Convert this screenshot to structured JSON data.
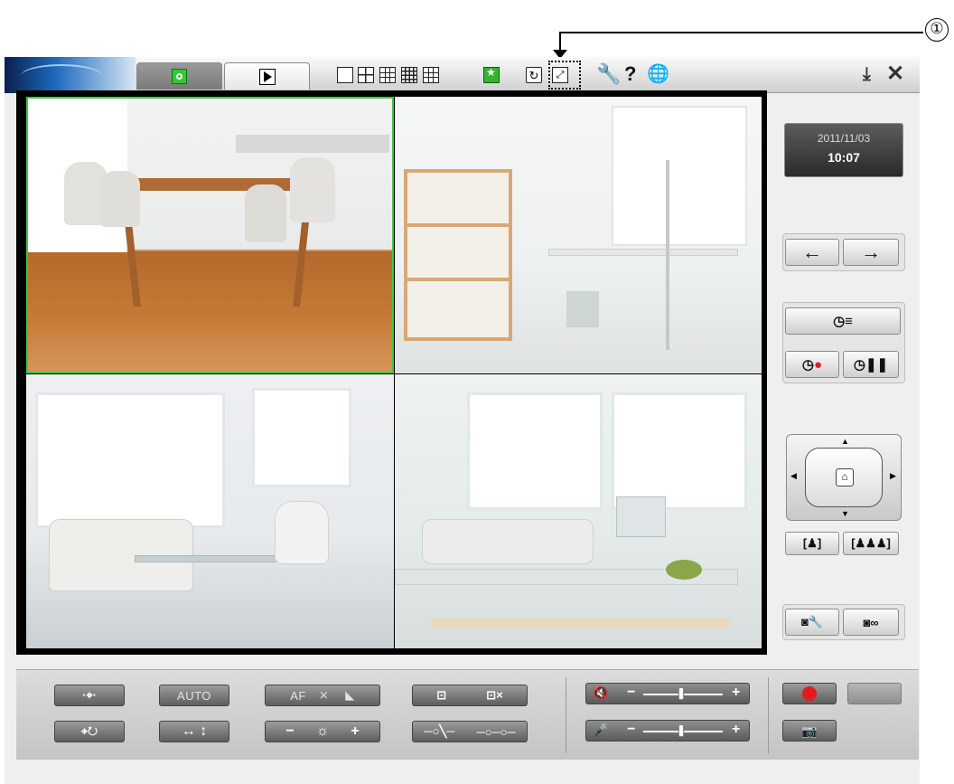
{
  "callout": {
    "number": "①"
  },
  "topbar": {
    "tabs": [
      {
        "name": "live"
      },
      {
        "name": "playback"
      }
    ],
    "tools": [
      "single-view",
      "quad-view",
      "nine-view",
      "sixteen-view",
      "twelve-view",
      "sequence-view",
      "refresh",
      "fullscreen",
      "settings",
      "help",
      "language"
    ]
  },
  "datetime": {
    "date": "2011/11/03",
    "time": "10:07"
  },
  "bottom": {
    "auto_label": "AUTO",
    "af_label": "AF"
  },
  "colors": {
    "selected_camera": "#3fc83f",
    "record": "#e21b1b",
    "live_tab": "#33c933"
  }
}
